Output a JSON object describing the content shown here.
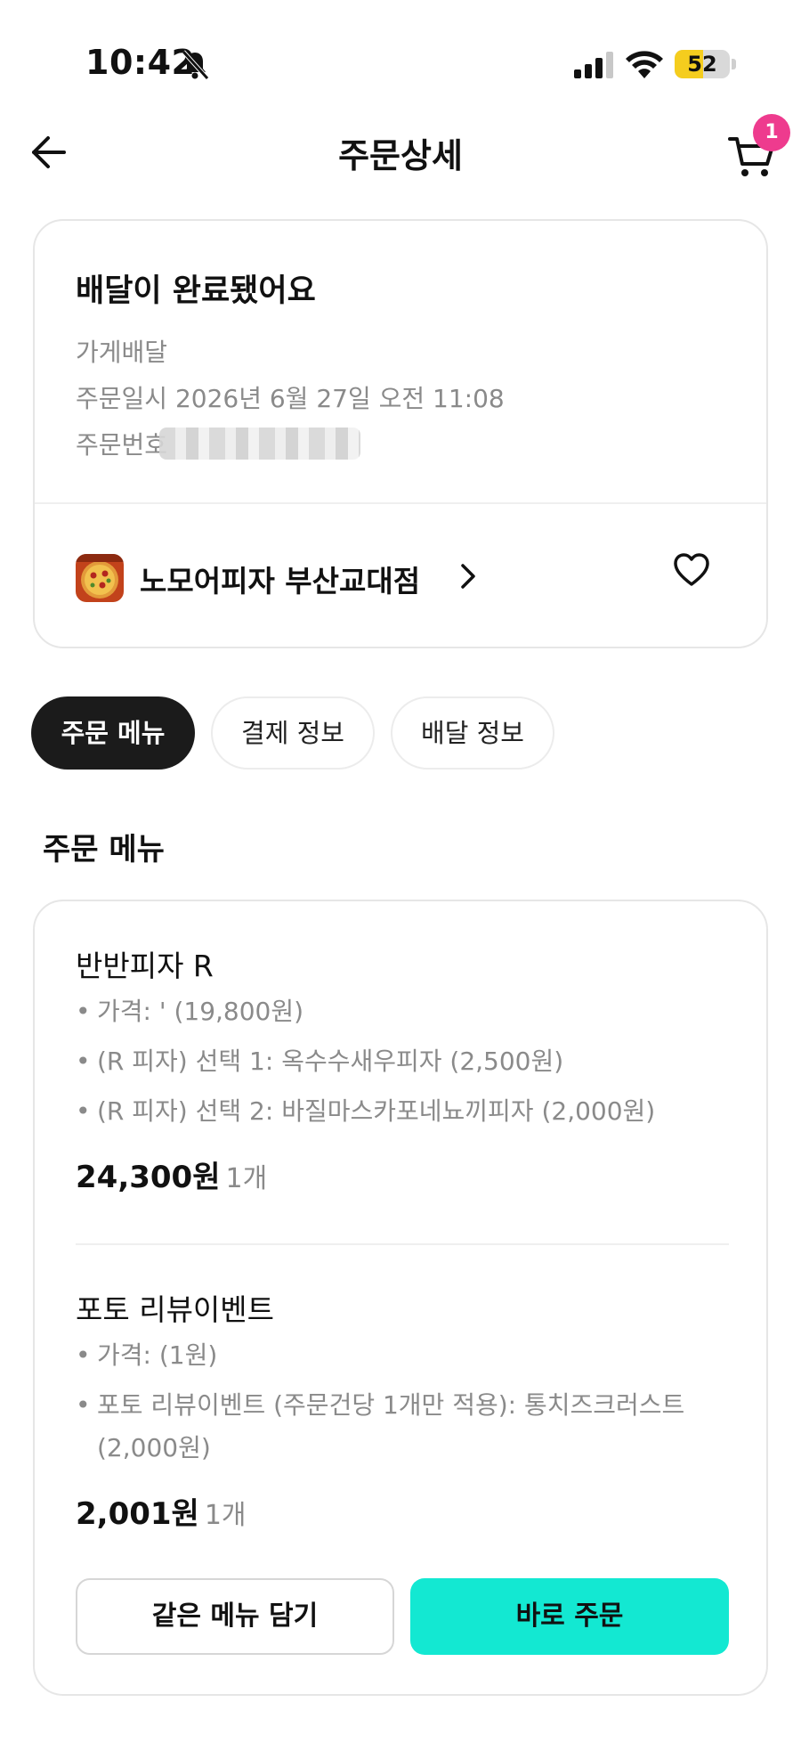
{
  "status_bar": {
    "time": "10:42",
    "battery_level": 52,
    "battery_label": "52",
    "icons": [
      "bell-muted-icon",
      "signal-icon",
      "wifi-icon",
      "battery-icon"
    ]
  },
  "header": {
    "title": "주문상세",
    "cart_badge": "1",
    "icons": [
      "back-arrow-icon",
      "cart-icon"
    ]
  },
  "order": {
    "status_title": "배달이 완료됐어요",
    "type": "가게배달",
    "date_label": "주문일시 2026년 6월 27일 오전 11:08",
    "number_label": "주문번호"
  },
  "store": {
    "name": "노모어피자 부산교대점",
    "icons": [
      "pizza-thumbnail",
      "chevron-right-icon",
      "heart-icon"
    ]
  },
  "tabs": [
    {
      "label": "주문 메뉴",
      "active": true
    },
    {
      "label": "결제 정보",
      "active": false
    },
    {
      "label": "배달 정보",
      "active": false
    }
  ],
  "section_title": "주문 메뉴",
  "items": [
    {
      "name": "반반피자 R",
      "options": [
        "가격: ' (19,800원)",
        "(R 피자) 선택 1: 옥수수새우피자 (2,500원)",
        "(R 피자) 선택 2: 바질마스카포네뇨끼피자 (2,000원)"
      ],
      "price": "24,300원",
      "qty": "1개"
    },
    {
      "name": "포토 리뷰이벤트",
      "options": [
        "가격:  (1원)",
        "포토 리뷰이벤트 (주문건당 1개만 적용): 통치즈크러스트",
        "(2,000원)"
      ],
      "price": "2,001원",
      "qty": "1개"
    }
  ],
  "buttons": {
    "same_menu": "같은 메뉴 담기",
    "order_now": "바로 주문"
  },
  "colors": {
    "accent": "#13e8d2",
    "badge": "#ee3b8e",
    "tab_active": "#1b1b1b",
    "battery": "#f5cd1e"
  }
}
